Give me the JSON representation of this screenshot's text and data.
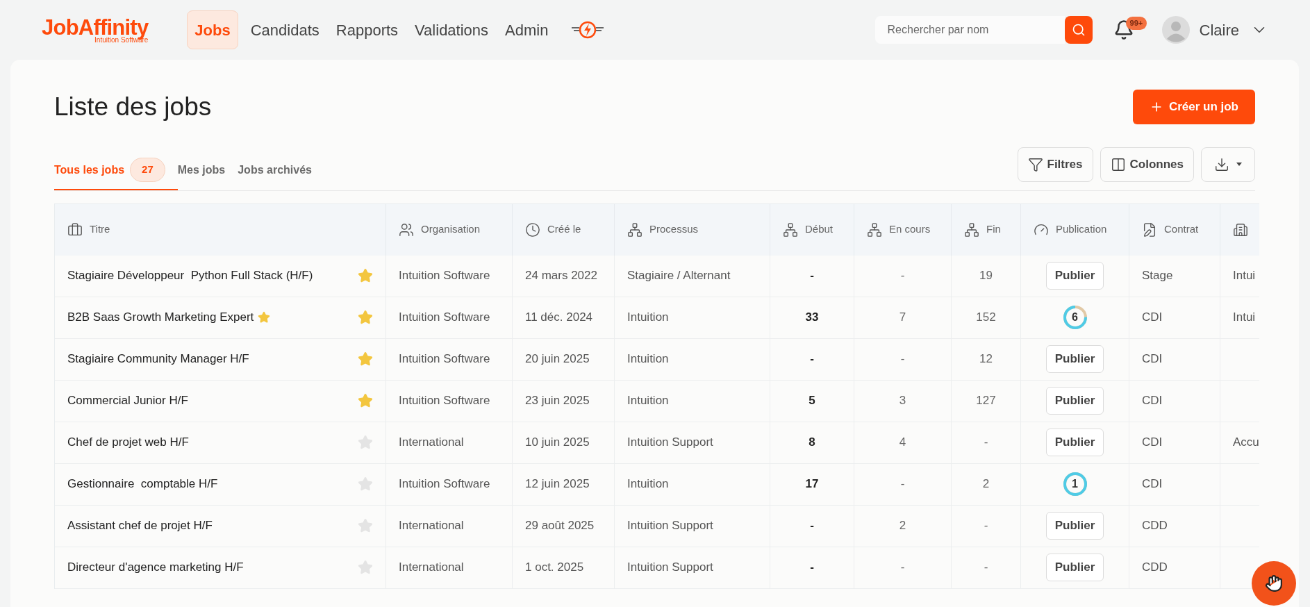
{
  "brand": {
    "name": "JobAffinity",
    "subtitle": "Intuition Software"
  },
  "nav": [
    {
      "label": "Jobs",
      "selected": true
    },
    {
      "label": "Candidats",
      "selected": false
    },
    {
      "label": "Rapports",
      "selected": false
    },
    {
      "label": "Validations",
      "selected": false
    },
    {
      "label": "Admin",
      "selected": false
    }
  ],
  "search": {
    "placeholder": "Rechercher par nom"
  },
  "notifications": {
    "badge": "99+"
  },
  "user": {
    "name": "Claire"
  },
  "page": {
    "title": "Liste des jobs",
    "create_button": "Créer un job"
  },
  "tabs": [
    {
      "label": "Tous les jobs",
      "count": "27",
      "selected": true
    },
    {
      "label": "Mes jobs",
      "selected": false
    },
    {
      "label": "Jobs archivés",
      "selected": false
    }
  ],
  "toolbar": {
    "filters": "Filtres",
    "columns": "Colonnes"
  },
  "table": {
    "columns": [
      "Titre",
      "Organisation",
      "Créé le",
      "Processus",
      "Début",
      "En cours",
      "Fin",
      "Publication",
      "Contrat"
    ],
    "rows": [
      {
        "title": "Stagiaire Développeur  Python Full Stack (H/F)",
        "title_star": false,
        "favorite": true,
        "organisation": "Intuition Software",
        "created": "24 mars 2022",
        "process": "Stagiaire / Alternant",
        "start": "-",
        "ongoing": "-",
        "end": "19",
        "publication": {
          "kind": "button",
          "label": "Publier"
        },
        "contract": "Stage",
        "column_10": "Intui"
      },
      {
        "title": "B2B Saas Growth Marketing Expert",
        "title_star": true,
        "favorite": true,
        "organisation": "Intuition Software",
        "created": "11 déc. 2024",
        "process": "Intuition",
        "start": "33",
        "ongoing": "7",
        "end": "152",
        "publication": {
          "kind": "ring",
          "label": "6",
          "level": 0.75
        },
        "contract": "CDI",
        "column_10": "Intui"
      },
      {
        "title": "Stagiaire Community Manager H/F",
        "title_star": false,
        "favorite": true,
        "organisation": "Intuition Software",
        "created": "20 juin 2025",
        "process": "Intuition",
        "start": "-",
        "ongoing": "-",
        "end": "12",
        "publication": {
          "kind": "button",
          "label": "Publier"
        },
        "contract": "CDI"
      },
      {
        "title": "Commercial Junior H/F",
        "title_star": false,
        "favorite": true,
        "organisation": "Intuition Software",
        "created": "23 juin 2025",
        "process": "Intuition",
        "start": "5",
        "ongoing": "3",
        "end": "127",
        "publication": {
          "kind": "button",
          "label": "Publier"
        },
        "contract": "CDI"
      },
      {
        "title": "Chef de projet web H/F",
        "title_star": false,
        "favorite": false,
        "organisation": "International",
        "created": "10 juin 2025",
        "process": "Intuition Support",
        "start": "8",
        "ongoing": "4",
        "end": "-",
        "publication": {
          "kind": "button",
          "label": "Publier"
        },
        "contract": "CDI",
        "column_10": "Accu"
      },
      {
        "title": "Gestionnaire  comptable H/F",
        "title_star": false,
        "favorite": false,
        "organisation": "Intuition Software",
        "created": "12 juin 2025",
        "process": "Intuition",
        "start": "17",
        "ongoing": "-",
        "end": "2",
        "publication": {
          "kind": "ring",
          "label": "1",
          "level": 1
        },
        "contract": "CDI"
      },
      {
        "title": "Assistant chef de projet H/F",
        "title_star": false,
        "favorite": false,
        "organisation": "International",
        "created": "29 août 2025",
        "process": "Intuition Support",
        "start": "-",
        "ongoing": "2",
        "end": "-",
        "publication": {
          "kind": "button",
          "label": "Publier"
        },
        "contract": "CDD"
      },
      {
        "title": "Directeur d'agence marketing H/F",
        "title_star": false,
        "favorite": false,
        "organisation": "International",
        "created": "1 oct. 2025",
        "process": "Intuition Support",
        "start": "-",
        "ongoing": "-",
        "end": "-",
        "publication": {
          "kind": "button",
          "label": "Publier"
        },
        "contract": "CDD"
      }
    ]
  }
}
